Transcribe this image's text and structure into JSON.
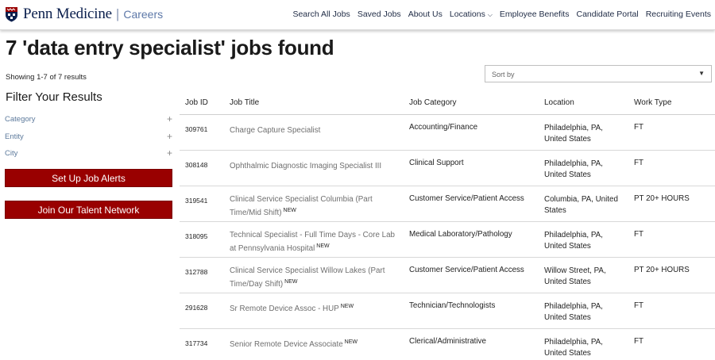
{
  "header": {
    "brand": "Penn Medicine",
    "separator": "|",
    "section": "Careers",
    "nav": [
      {
        "label": "Search All Jobs"
      },
      {
        "label": "Saved Jobs"
      },
      {
        "label": "About Us"
      },
      {
        "label": "Locations"
      },
      {
        "label": "Employee Benefits"
      },
      {
        "label": "Candidate Portal"
      },
      {
        "label": "Recruiting Events"
      }
    ]
  },
  "results": {
    "heading": "7 'data entry specialist' jobs found",
    "showing": "Showing 1-7 of 7 results"
  },
  "sort": {
    "label": "Sort by"
  },
  "filters": {
    "title": "Filter Your Results",
    "facets": [
      {
        "label": "Category"
      },
      {
        "label": "Entity"
      },
      {
        "label": "City"
      }
    ],
    "alerts_button": "Set Up Job Alerts",
    "talent_button": "Join Our Talent Network"
  },
  "table": {
    "columns": [
      "Job ID",
      "Job Title",
      "Job Category",
      "Location",
      "Work Type"
    ],
    "rows": [
      {
        "id": "309761",
        "title": "Charge Capture Specialist",
        "new": "",
        "category": "Accounting/Finance",
        "location": "Philadelphia, PA, United States",
        "work_type": "FT"
      },
      {
        "id": "308148",
        "title": "Ophthalmic Diagnostic Imaging Specialist III",
        "new": "",
        "category": "Clinical Support",
        "location": "Philadelphia, PA, United States",
        "work_type": "FT"
      },
      {
        "id": "319541",
        "title": "Clinical Service Specialist Columbia (Part Time/Mid Shift)",
        "new": "NEW",
        "category": "Customer Service/Patient Access",
        "location": "Columbia, PA, United States",
        "work_type": "PT 20+ HOURS"
      },
      {
        "id": "318095",
        "title": "Technical Specialist - Full Time Days - Core Lab at Pennsylvania Hospital",
        "new": "NEW",
        "category": "Medical Laboratory/Pathology",
        "location": "Philadelphia, PA, United States",
        "work_type": "FT"
      },
      {
        "id": "312788",
        "title": "Clinical Service Specialist Willow Lakes (Part Time/Day Shift)",
        "new": "NEW",
        "category": "Customer Service/Patient Access",
        "location": "Willow Street, PA, United States",
        "work_type": "PT 20+ HOURS"
      },
      {
        "id": "291628",
        "title": "Sr Remote Device Assoc - HUP",
        "new": "NEW",
        "category": "Technician/Technologists",
        "location": "Philadelphia, PA, United States",
        "work_type": "FT"
      },
      {
        "id": "317734",
        "title": "Senior Remote Device Associate",
        "new": "NEW",
        "category": "Clerical/Administrative",
        "location": "Philadelphia, PA, United States",
        "work_type": "FT"
      }
    ]
  },
  "colors": {
    "brand_navy": "#0b1f4d",
    "button_red": "#990000",
    "link_blue": "#5d7a9c"
  },
  "icons": {
    "logo": "penn-shield-icon",
    "dropdown": "chevron-down-icon",
    "expand": "plus-icon"
  }
}
